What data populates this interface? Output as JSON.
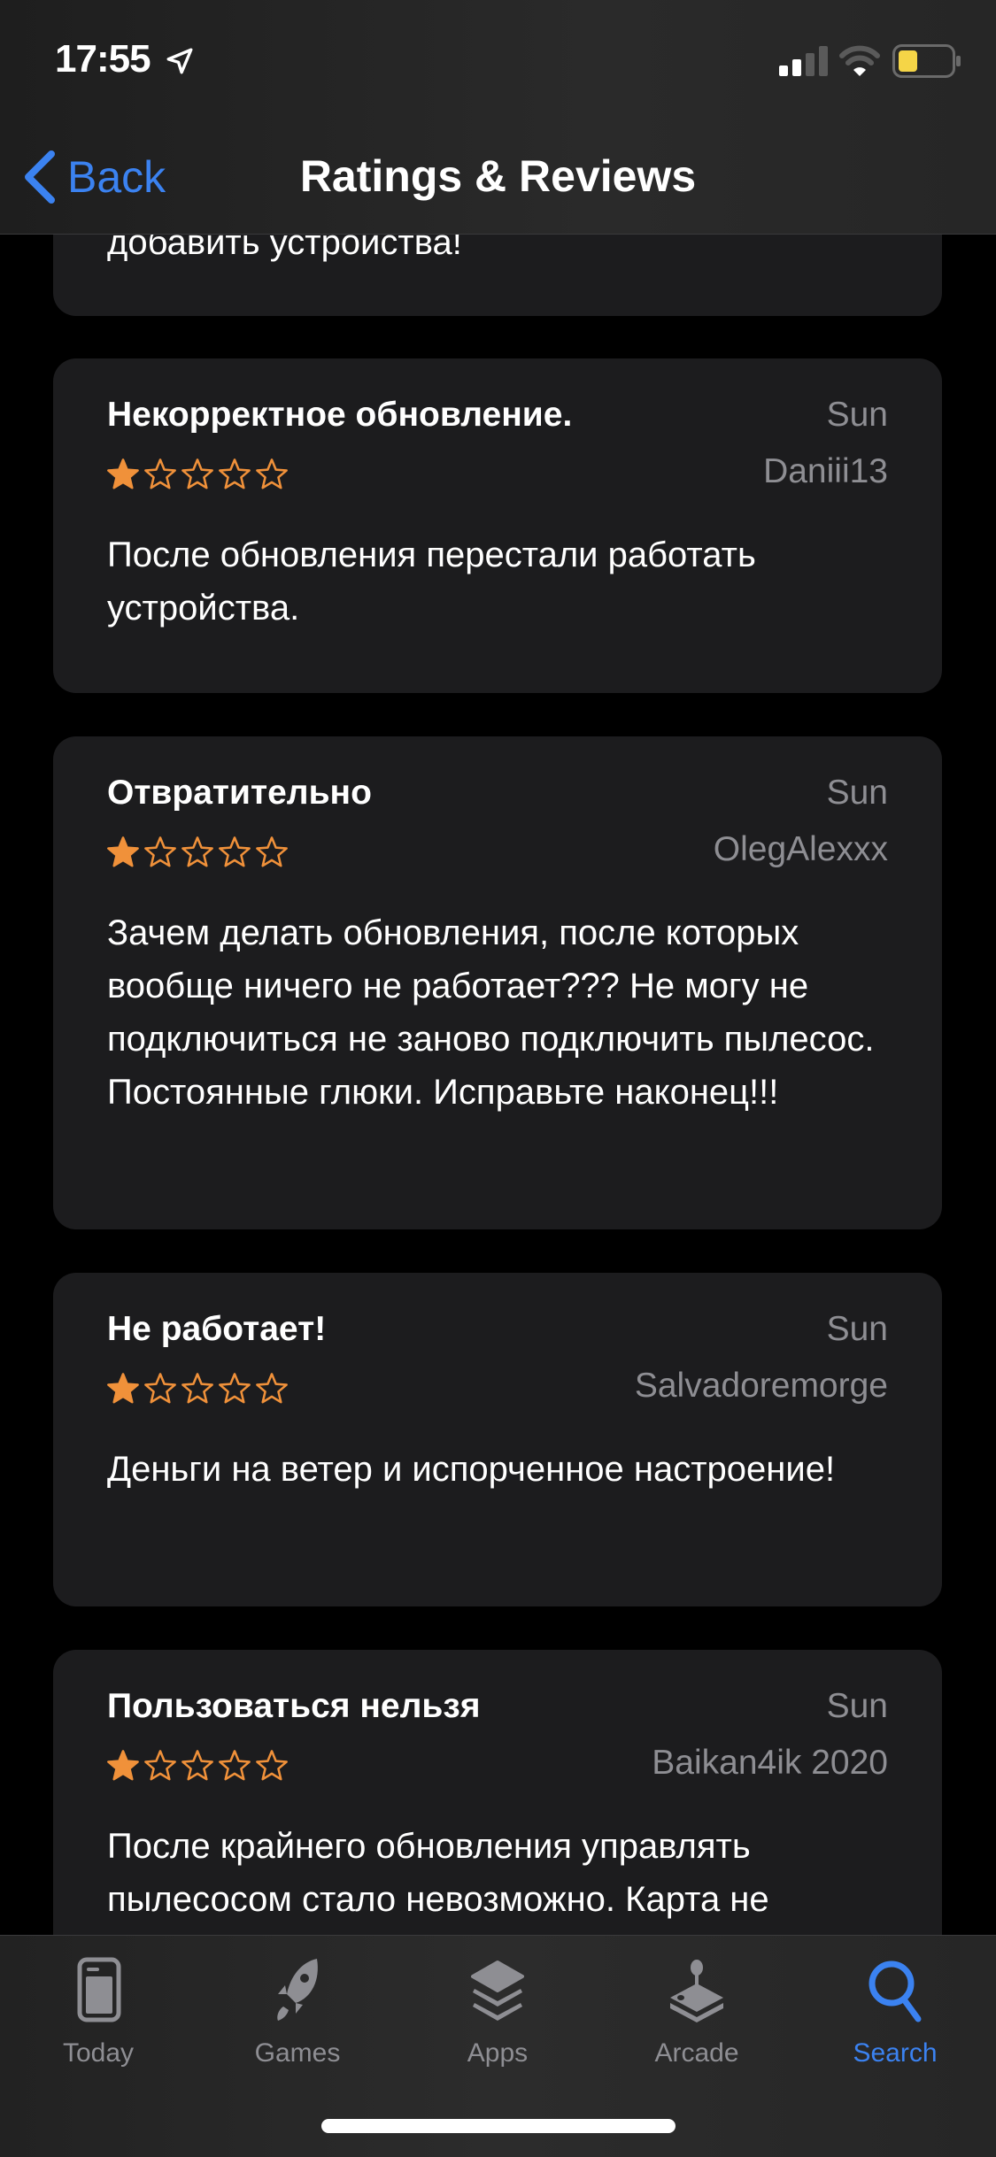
{
  "status_bar": {
    "time": "17:55",
    "location_icon": "location-arrow-icon",
    "signal_icon": "cellular-signal-icon",
    "wifi_icon": "wifi-icon",
    "battery_icon": "battery-low-icon",
    "battery_color": "#f5d547"
  },
  "nav": {
    "back_label": "Back",
    "title": "Ratings & Reviews",
    "accent": "#3b82f0"
  },
  "reviews": [
    {
      "partial": true,
      "body": "добавить устройства!"
    },
    {
      "title": "Некорректное обновление.",
      "date": "Sun",
      "author": "Daniii13",
      "rating": 1,
      "max_rating": 5,
      "body": "После обновления перестали работать устройства."
    },
    {
      "title": "Отвратительно",
      "date": "Sun",
      "author": "OlegAlexxx",
      "rating": 1,
      "max_rating": 5,
      "body": "Зачем делать обновления, после которых вообще ничего не работает??? Не могу не подключиться не заново подключить пылесос. Постоянные глюки. Исправьте наконец!!!"
    },
    {
      "title": "Не работает!",
      "date": "Sun",
      "author": "Salvadoremorge",
      "rating": 1,
      "max_rating": 5,
      "body": "Деньги на ветер и испорченное настроение!"
    },
    {
      "title": "Пользоваться нельзя",
      "date": "Sun",
      "author": "Baikan4ik 2020",
      "rating": 1,
      "max_rating": 5,
      "body": "После крайнего обновления управлять пылесосом стало невозможно. Карта не"
    }
  ],
  "star_color": "#f0913a",
  "tabbar": {
    "items": [
      {
        "label": "Today",
        "icon": "today-icon",
        "active": false
      },
      {
        "label": "Games",
        "icon": "rocket-icon",
        "active": false
      },
      {
        "label": "Apps",
        "icon": "apps-stack-icon",
        "active": false
      },
      {
        "label": "Arcade",
        "icon": "joystick-icon",
        "active": false
      },
      {
        "label": "Search",
        "icon": "search-icon",
        "active": true
      }
    ]
  }
}
